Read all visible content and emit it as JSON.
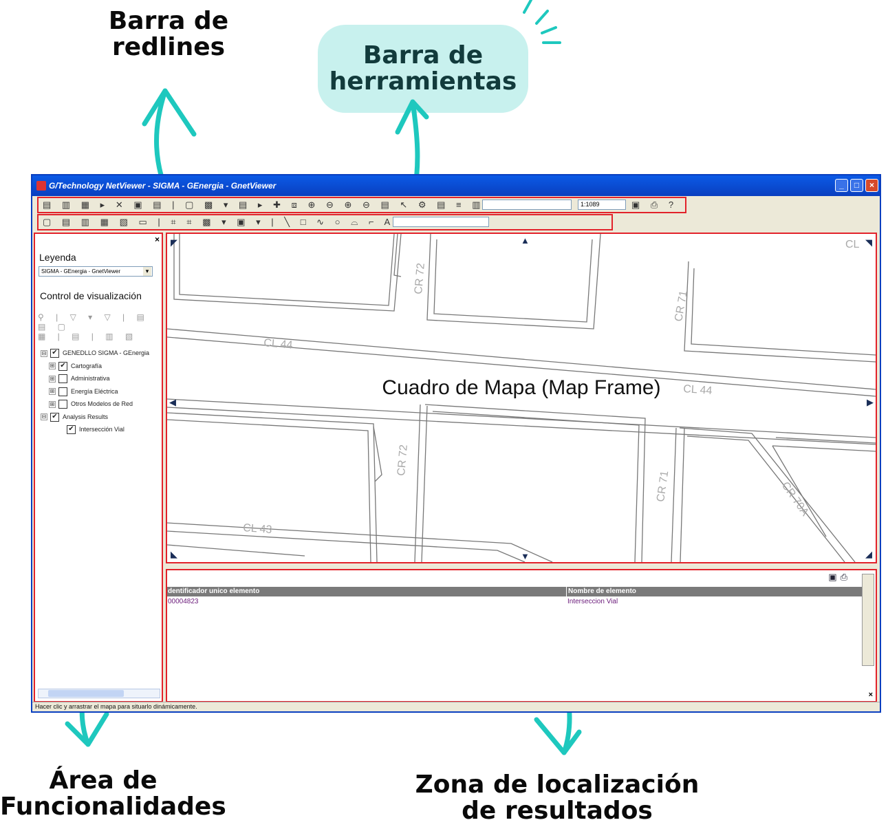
{
  "annotations": {
    "redlines_bar": "Barra de redlines",
    "toolbar": "Barra de herramientas",
    "function_area": "Área de Funcionalidades",
    "results_zone": "Zona de localización de resultados",
    "accent_color": "#1ec8be"
  },
  "window": {
    "title": "G/Technology NetViewer - SIGMA - GEnergia - GnetViewer",
    "scale": "1:1089",
    "status": "Hacer clic y arrastrar el mapa para situarlo dinámicamente."
  },
  "legend_panel": {
    "close": "×",
    "leyenda_title": "Leyenda",
    "leyenda_selected": "SIGMA - GEnergia - GnetViewer",
    "control_title": "Control de visualización",
    "tree": [
      {
        "label": "GENEDLLO SIGMA - GEnergia",
        "checked": true,
        "expander": "⊟"
      },
      {
        "label": "Cartografía",
        "checked": true,
        "expander": "⊞"
      },
      {
        "label": "Administrativa",
        "checked": false,
        "expander": "⊞"
      },
      {
        "label": "Energía Eléctrica",
        "checked": false,
        "expander": "⊞"
      },
      {
        "label": "Otros Modelos de Red",
        "checked": false,
        "expander": "⊞"
      },
      {
        "label": "Analysis Results",
        "checked": true,
        "expander": "⊟"
      },
      {
        "label": "Intersección Vial",
        "checked": true,
        "expander": ""
      }
    ]
  },
  "map": {
    "caption": "Cuadro de Mapa (Map Frame)",
    "streets": [
      "CL 44",
      "CL 44",
      "CL 43",
      "CR 72",
      "CR 72",
      "CR 71",
      "CR 71",
      "CR 70A",
      "CL"
    ]
  },
  "results": {
    "columns": [
      "dentificador unico elemento",
      "Nombre de elemento"
    ],
    "rows": [
      [
        "00004823",
        "Interseccion Vial"
      ]
    ],
    "close": "×"
  }
}
